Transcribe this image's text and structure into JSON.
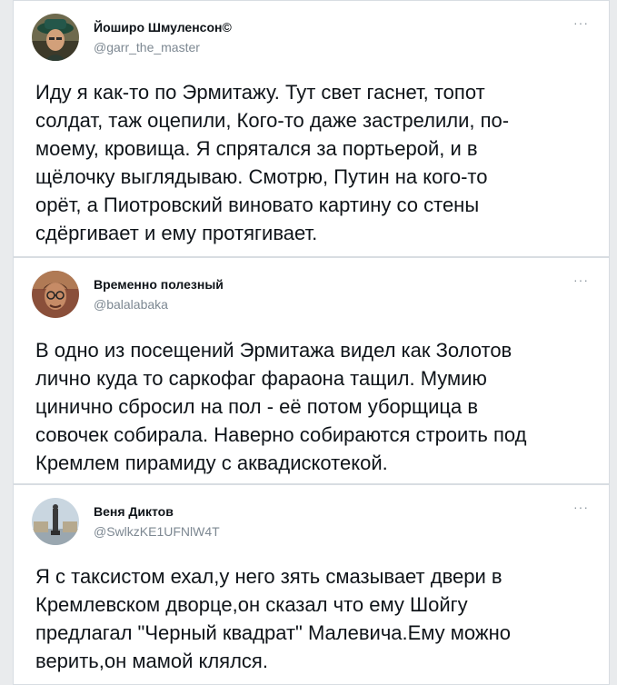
{
  "tweets": [
    {
      "author_name": "Йоширо Шмуленсон©",
      "handle": "@garr_the_master",
      "more_label": "···",
      "avatar_icon": "avatar-man-green-hat",
      "text": "Иду я как-то по Эрмитажу. Тут свет гаснет, топот\nсолдат, таж оцепили, Кого-то даже застрелили, по-\nмоему, кровища. Я спрятался за портьерой, и в\nщёлочку выглядываю. Смотрю, Путин на кого-то\nорёт, а Пиотровский виновато картину со стены\nсдёргивает и ему протягивает."
    },
    {
      "author_name": "Временно полезный",
      "handle": "@balalabaka",
      "more_label": "···",
      "avatar_icon": "avatar-man-glasses",
      "text": "В одно из посещений Эрмитажа видел как Золотов\nлично куда то саркофаг фараона тащил. Мумию\nцинично сбросил на пол - её потом уборщица в\nсовочек собирала. Наверно собираются строить под\nКремлем пирамиду с аквадискотекой."
    },
    {
      "author_name": "Веня Диктов",
      "handle": "@SwlkzKE1UFNlW4T",
      "more_label": "···",
      "avatar_icon": "avatar-monument",
      "text": "Я с таксистом ехал,у него зять смазывает двери в\nКремлевском дворце,он сказал что ему Шойгу\nпредлагал \"Черный квадрат\" Малевича.Ему можно\nверить,он мамой клялся."
    }
  ],
  "colors": {
    "background": "#e9ebed",
    "card": "#ffffff",
    "text": "#0f1419",
    "secondary": "#7d8892",
    "border": "#d8dde2"
  }
}
